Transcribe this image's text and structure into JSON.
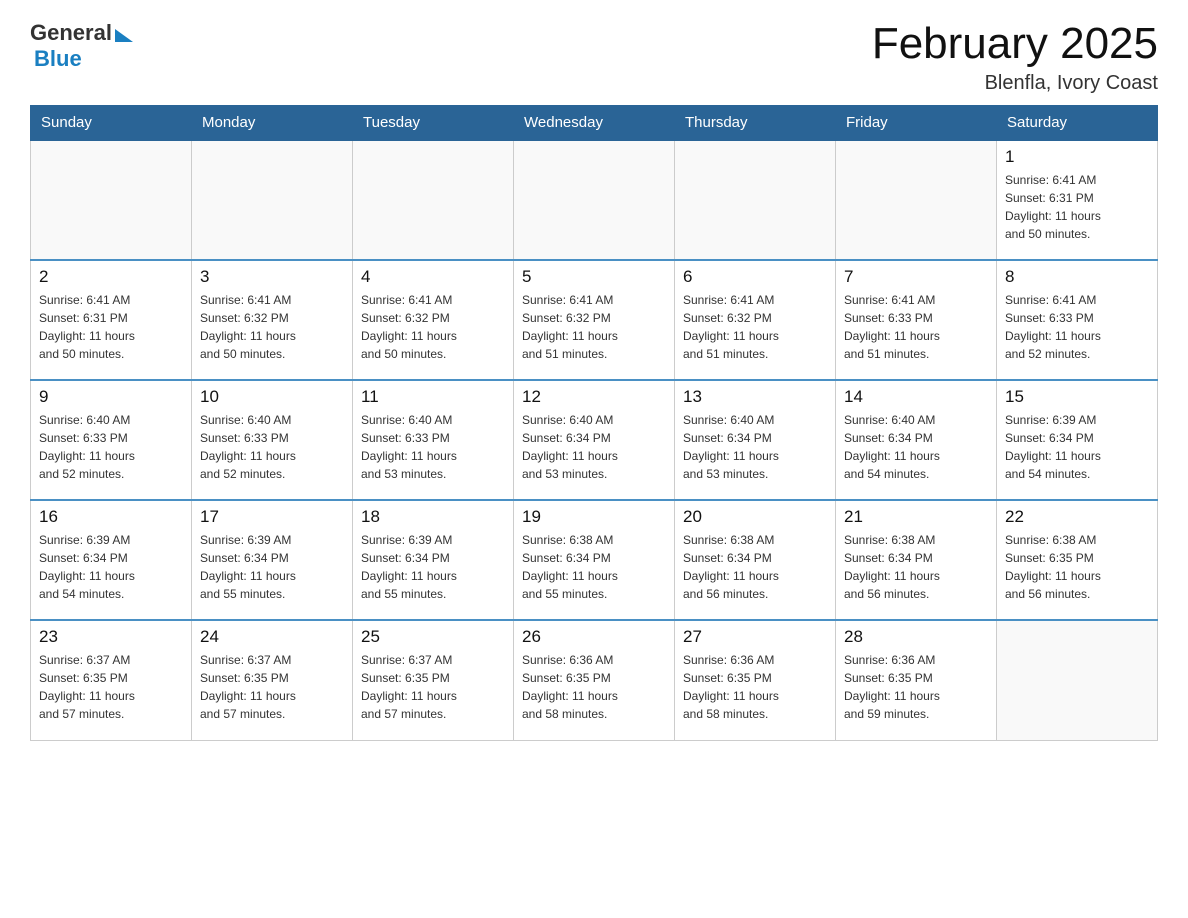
{
  "header": {
    "logo": {
      "general": "General",
      "blue": "Blue"
    },
    "title": "February 2025",
    "subtitle": "Blenfla, Ivory Coast"
  },
  "days_of_week": [
    "Sunday",
    "Monday",
    "Tuesday",
    "Wednesday",
    "Thursday",
    "Friday",
    "Saturday"
  ],
  "weeks": [
    [
      {
        "day": "",
        "info": ""
      },
      {
        "day": "",
        "info": ""
      },
      {
        "day": "",
        "info": ""
      },
      {
        "day": "",
        "info": ""
      },
      {
        "day": "",
        "info": ""
      },
      {
        "day": "",
        "info": ""
      },
      {
        "day": "1",
        "info": "Sunrise: 6:41 AM\nSunset: 6:31 PM\nDaylight: 11 hours\nand 50 minutes."
      }
    ],
    [
      {
        "day": "2",
        "info": "Sunrise: 6:41 AM\nSunset: 6:31 PM\nDaylight: 11 hours\nand 50 minutes."
      },
      {
        "day": "3",
        "info": "Sunrise: 6:41 AM\nSunset: 6:32 PM\nDaylight: 11 hours\nand 50 minutes."
      },
      {
        "day": "4",
        "info": "Sunrise: 6:41 AM\nSunset: 6:32 PM\nDaylight: 11 hours\nand 50 minutes."
      },
      {
        "day": "5",
        "info": "Sunrise: 6:41 AM\nSunset: 6:32 PM\nDaylight: 11 hours\nand 51 minutes."
      },
      {
        "day": "6",
        "info": "Sunrise: 6:41 AM\nSunset: 6:32 PM\nDaylight: 11 hours\nand 51 minutes."
      },
      {
        "day": "7",
        "info": "Sunrise: 6:41 AM\nSunset: 6:33 PM\nDaylight: 11 hours\nand 51 minutes."
      },
      {
        "day": "8",
        "info": "Sunrise: 6:41 AM\nSunset: 6:33 PM\nDaylight: 11 hours\nand 52 minutes."
      }
    ],
    [
      {
        "day": "9",
        "info": "Sunrise: 6:40 AM\nSunset: 6:33 PM\nDaylight: 11 hours\nand 52 minutes."
      },
      {
        "day": "10",
        "info": "Sunrise: 6:40 AM\nSunset: 6:33 PM\nDaylight: 11 hours\nand 52 minutes."
      },
      {
        "day": "11",
        "info": "Sunrise: 6:40 AM\nSunset: 6:33 PM\nDaylight: 11 hours\nand 53 minutes."
      },
      {
        "day": "12",
        "info": "Sunrise: 6:40 AM\nSunset: 6:34 PM\nDaylight: 11 hours\nand 53 minutes."
      },
      {
        "day": "13",
        "info": "Sunrise: 6:40 AM\nSunset: 6:34 PM\nDaylight: 11 hours\nand 53 minutes."
      },
      {
        "day": "14",
        "info": "Sunrise: 6:40 AM\nSunset: 6:34 PM\nDaylight: 11 hours\nand 54 minutes."
      },
      {
        "day": "15",
        "info": "Sunrise: 6:39 AM\nSunset: 6:34 PM\nDaylight: 11 hours\nand 54 minutes."
      }
    ],
    [
      {
        "day": "16",
        "info": "Sunrise: 6:39 AM\nSunset: 6:34 PM\nDaylight: 11 hours\nand 54 minutes."
      },
      {
        "day": "17",
        "info": "Sunrise: 6:39 AM\nSunset: 6:34 PM\nDaylight: 11 hours\nand 55 minutes."
      },
      {
        "day": "18",
        "info": "Sunrise: 6:39 AM\nSunset: 6:34 PM\nDaylight: 11 hours\nand 55 minutes."
      },
      {
        "day": "19",
        "info": "Sunrise: 6:38 AM\nSunset: 6:34 PM\nDaylight: 11 hours\nand 55 minutes."
      },
      {
        "day": "20",
        "info": "Sunrise: 6:38 AM\nSunset: 6:34 PM\nDaylight: 11 hours\nand 56 minutes."
      },
      {
        "day": "21",
        "info": "Sunrise: 6:38 AM\nSunset: 6:34 PM\nDaylight: 11 hours\nand 56 minutes."
      },
      {
        "day": "22",
        "info": "Sunrise: 6:38 AM\nSunset: 6:35 PM\nDaylight: 11 hours\nand 56 minutes."
      }
    ],
    [
      {
        "day": "23",
        "info": "Sunrise: 6:37 AM\nSunset: 6:35 PM\nDaylight: 11 hours\nand 57 minutes."
      },
      {
        "day": "24",
        "info": "Sunrise: 6:37 AM\nSunset: 6:35 PM\nDaylight: 11 hours\nand 57 minutes."
      },
      {
        "day": "25",
        "info": "Sunrise: 6:37 AM\nSunset: 6:35 PM\nDaylight: 11 hours\nand 57 minutes."
      },
      {
        "day": "26",
        "info": "Sunrise: 6:36 AM\nSunset: 6:35 PM\nDaylight: 11 hours\nand 58 minutes."
      },
      {
        "day": "27",
        "info": "Sunrise: 6:36 AM\nSunset: 6:35 PM\nDaylight: 11 hours\nand 58 minutes."
      },
      {
        "day": "28",
        "info": "Sunrise: 6:36 AM\nSunset: 6:35 PM\nDaylight: 11 hours\nand 59 minutes."
      },
      {
        "day": "",
        "info": ""
      }
    ]
  ]
}
